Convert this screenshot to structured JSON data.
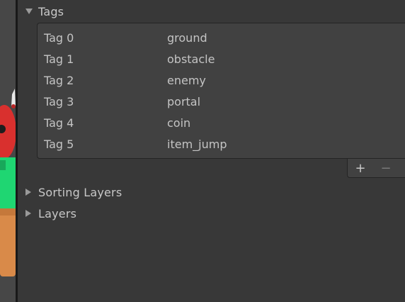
{
  "tags_section": {
    "label": "Tags",
    "expanded": true,
    "items": [
      {
        "name": "Tag 0",
        "value": "ground"
      },
      {
        "name": "Tag 1",
        "value": "obstacle"
      },
      {
        "name": "Tag 2",
        "value": "enemy"
      },
      {
        "name": "Tag 3",
        "value": "portal"
      },
      {
        "name": "Tag 4",
        "value": "coin"
      },
      {
        "name": "Tag 5",
        "value": "item_jump"
      }
    ],
    "add_icon": "+",
    "remove_icon": "−"
  },
  "sorting_layers_section": {
    "label": "Sorting Layers",
    "expanded": false
  },
  "layers_section": {
    "label": "Layers",
    "expanded": false
  },
  "colors": {
    "panel_bg": "#383838",
    "list_bg": "#414141",
    "text": "#c4c4c4"
  }
}
